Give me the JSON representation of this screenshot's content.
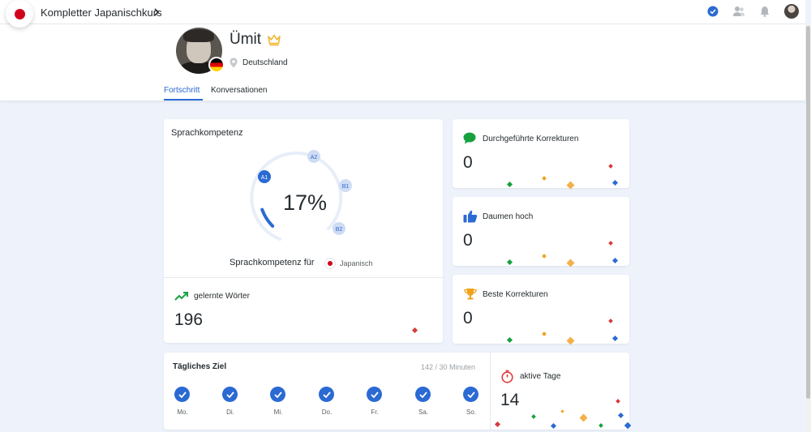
{
  "header": {
    "course_title": "Kompletter Japanischkurs"
  },
  "profile": {
    "name": "Ümit",
    "country": "Deutschland",
    "tabs": [
      "Fortschritt",
      "Konversationen"
    ]
  },
  "language_proficiency": {
    "title": "Sprachkompetenz",
    "levels": [
      "A1",
      "A2",
      "B1",
      "B2"
    ],
    "current_level": "A1",
    "percent": "17%",
    "percent_value": 17,
    "subtitle": "Sprachkompetenz für",
    "language": "Japanisch"
  },
  "learned_words": {
    "title": "gelernte Wörter",
    "value": "196"
  },
  "stats": [
    {
      "title": "Durchgeführte Korrekturen",
      "value": "0"
    },
    {
      "title": "Daumen hoch",
      "value": "0"
    },
    {
      "title": "Beste Korrekturen",
      "value": "0"
    }
  ],
  "daily_goal": {
    "title": "Tägliches Ziel",
    "progress": "142 / 30 Minuten",
    "days": [
      "Mo.",
      "Di.",
      "Mi.",
      "Do.",
      "Fr.",
      "Sa.",
      "So."
    ]
  },
  "active_days": {
    "title": "aktive Tage",
    "value": "14"
  },
  "colors": {
    "accent": "#2b6ad3",
    "green": "#17a03f",
    "trophy": "#f0a21c",
    "timer": "#e03b3b",
    "japan_red": "#d0021b"
  }
}
